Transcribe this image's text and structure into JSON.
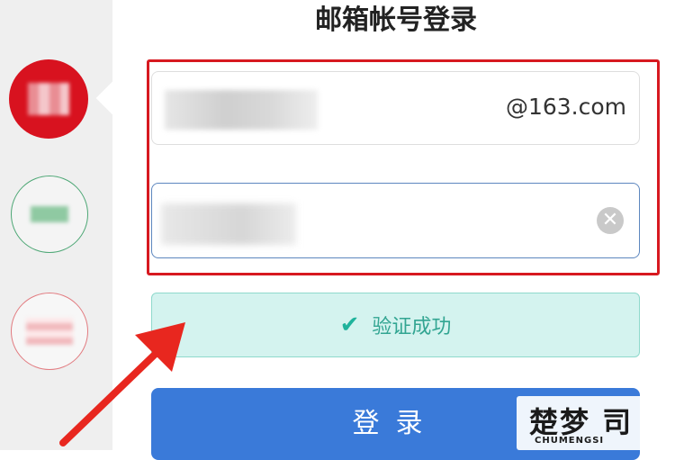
{
  "page_title": "邮箱帐号登录",
  "account_field": {
    "value_masked": "",
    "domain_suffix": "@163.com"
  },
  "password_field": {
    "value_masked": "",
    "clear_icon": "✕"
  },
  "verification": {
    "icon": "check-icon",
    "text": "验证成功"
  },
  "login_button": {
    "label": "登录"
  },
  "watermark": {
    "logo_text": "楚梦 司",
    "sub_text": "CHUMENGSI"
  },
  "colors": {
    "highlight_frame": "#d71920",
    "verify_bg": "#d4f3ef",
    "verify_text": "#32a592",
    "login_bg": "#3a7ad9",
    "arrow": "#e8271f"
  }
}
